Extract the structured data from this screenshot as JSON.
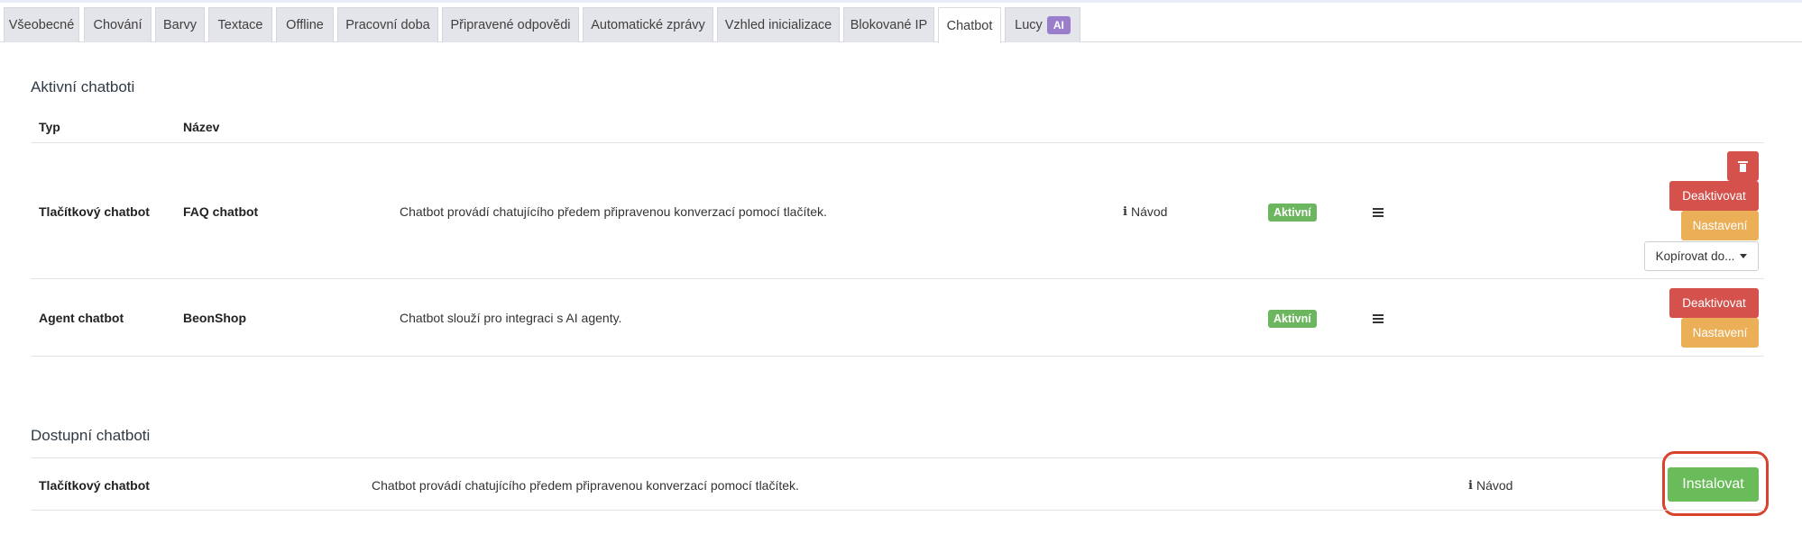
{
  "tabs": [
    {
      "label": "Všeobecné"
    },
    {
      "label": "Chování"
    },
    {
      "label": "Barvy"
    },
    {
      "label": "Textace"
    },
    {
      "label": "Offline"
    },
    {
      "label": "Pracovní doba"
    },
    {
      "label": "Připravené odpovědi"
    },
    {
      "label": "Automatické zprávy"
    },
    {
      "label": "Vzhled inicializace"
    },
    {
      "label": "Blokované IP"
    },
    {
      "label": "Chatbot",
      "active": true
    },
    {
      "label": "Lucy",
      "badge": "AI"
    }
  ],
  "active_section": {
    "title": "Aktivní chatboti",
    "columns": {
      "type": "Typ",
      "name": "Název"
    },
    "rows": [
      {
        "type": "Tlačítkový chatbot",
        "name": "FAQ chatbot",
        "description": "Chatbot provádí chatujícího předem připravenou konverzací pomocí tlačítek.",
        "guide": "Návod",
        "status": "Aktivní",
        "actions": {
          "deactivate": "Deaktivovat",
          "settings": "Nastavení",
          "copy": "Kopírovat do..."
        }
      },
      {
        "type": "Agent chatbot",
        "name": "BeonShop",
        "description": "Chatbot slouží pro integraci s AI agenty.",
        "status": "Aktivní",
        "actions": {
          "deactivate": "Deaktivovat",
          "settings": "Nastavení"
        }
      }
    ]
  },
  "available_section": {
    "title": "Dostupní chatboti",
    "rows": [
      {
        "type": "Tlačítkový chatbot",
        "description": "Chatbot provádí chatujícího předem připravenou konverzací pomocí tlačítek.",
        "guide": "Návod",
        "install": "Instalovat"
      }
    ]
  },
  "colors": {
    "danger": "#d5524c",
    "warning": "#ebaf57",
    "success": "#6abc5b",
    "ai_badge": "#9b7ecb",
    "highlight": "#d9432e"
  },
  "icons": [
    "trash-icon",
    "info-icon",
    "hamburger-menu-icon",
    "caret-down-icon"
  ]
}
